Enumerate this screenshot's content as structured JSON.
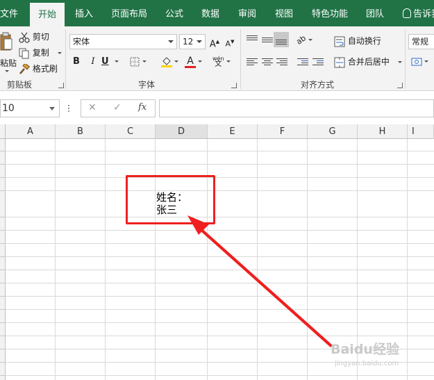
{
  "tabs": [
    {
      "label": "文件"
    },
    {
      "label": "开始"
    },
    {
      "label": "插入"
    },
    {
      "label": "页面布局"
    },
    {
      "label": "公式"
    },
    {
      "label": "数据"
    },
    {
      "label": "审阅"
    },
    {
      "label": "视图"
    },
    {
      "label": "特色功能"
    },
    {
      "label": "团队"
    }
  ],
  "tell_me": "告诉我",
  "clipboard": {
    "paste_label": "粘贴",
    "cut_label": "剪切",
    "copy_label": "复制",
    "format_painter_label": "格式刷",
    "group_label": "剪贴板"
  },
  "font": {
    "font_name": "宋体",
    "font_size": "12",
    "bold": "B",
    "italic": "I",
    "underline": "U",
    "grow": "A",
    "shrink": "A",
    "font_color": "A",
    "phonetic_top": "wén",
    "phonetic_bottom": "文",
    "group_label": "字体"
  },
  "alignment": {
    "wrap_text_label": "自动换行",
    "merge_center_label": "合并后居中",
    "group_label": "对齐方式"
  },
  "number": {
    "format": "常规"
  },
  "formula_bar": {
    "name_box": "10",
    "cancel": "✕",
    "enter": "✓",
    "fx": "fx",
    "content": ""
  },
  "columns": [
    "A",
    "B",
    "C",
    "D",
    "E",
    "F",
    "G",
    "H",
    "I"
  ],
  "cell_content": {
    "line1": "姓名：",
    "line2": "张三"
  },
  "watermark": {
    "brand": "Baidu经验",
    "url": "jingyan.baidu.com"
  },
  "colors": {
    "ribbon_green": "#217346",
    "highlight_red": "#ee2020",
    "fill_yellow": "#ffd400",
    "font_red": "#e02020"
  }
}
